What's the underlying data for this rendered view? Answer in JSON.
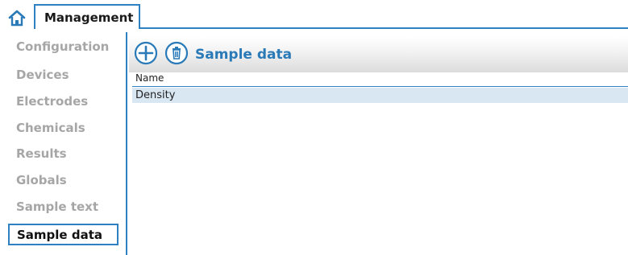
{
  "header": {
    "home_icon": "home-icon",
    "tab_label": "Management",
    "accent_color": "#2f80c0"
  },
  "sidebar": {
    "items": [
      {
        "label": "Configuration"
      },
      {
        "label": "Devices"
      },
      {
        "label": "Electrodes"
      },
      {
        "label": "Chemicals"
      },
      {
        "label": "Results"
      },
      {
        "label": "Globals"
      },
      {
        "label": "Sample text"
      },
      {
        "label": "Sample data",
        "active": true
      }
    ]
  },
  "toolbar": {
    "add_icon": "plus-circle-icon",
    "delete_icon": "trash-circle-icon",
    "title": "Sample data"
  },
  "table": {
    "columns": [
      "Name"
    ],
    "rows": [
      {
        "name": "Density",
        "selected": true
      }
    ]
  }
}
